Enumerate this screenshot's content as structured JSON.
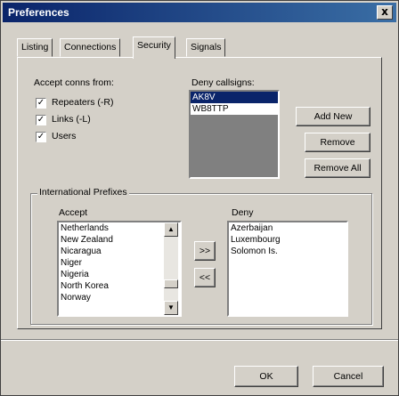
{
  "window": {
    "title": "Preferences",
    "close_glyph": "x"
  },
  "tabs": [
    {
      "label": "Listing"
    },
    {
      "label": "Connections"
    },
    {
      "label": "Security",
      "active": true
    },
    {
      "label": "Signals"
    }
  ],
  "accept_conns": {
    "heading": "Accept conns from:",
    "options": [
      {
        "label": "Repeaters (-R)",
        "checked": true
      },
      {
        "label": "Links (-L)",
        "checked": true
      },
      {
        "label": "Users",
        "checked": true
      }
    ]
  },
  "deny_callsigns": {
    "heading": "Deny callsigns:",
    "items": [
      "AK8V",
      "WB8TTP"
    ],
    "selected": "AK8V",
    "add_label": "Add New",
    "remove_label": "Remove",
    "remove_all_label": "Remove All"
  },
  "international": {
    "legend": "International Prefixes",
    "accept_heading": "Accept",
    "deny_heading": "Deny",
    "accept_items": [
      "Netherlands",
      "New Zealand",
      "Nicaragua",
      "Niger",
      "Nigeria",
      "North Korea",
      "Norway"
    ],
    "deny_items": [
      "Azerbaijan",
      "Luxembourg",
      "Solomon Is."
    ],
    "move_right_label": ">>",
    "move_left_label": "<<"
  },
  "footer": {
    "ok_label": "OK",
    "cancel_label": "Cancel"
  },
  "icons": {
    "check": "check-glyph",
    "arrow_up": "up-arrow-icon",
    "arrow_down": "down-arrow-icon"
  },
  "colors": {
    "title_bar": "#0a246a",
    "selection": "#0a246a",
    "face": "#d4d0c8"
  }
}
